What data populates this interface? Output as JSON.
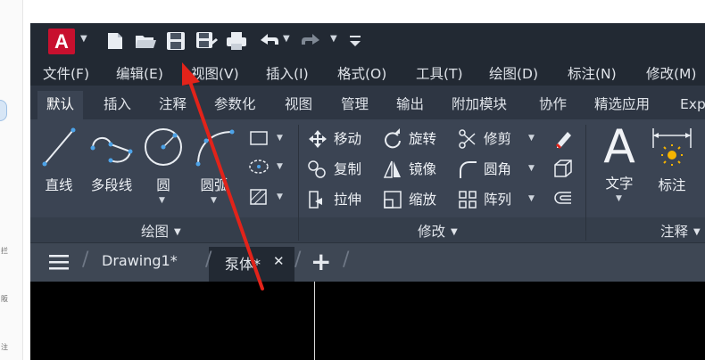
{
  "left_strip": {
    "texts": [
      "拦",
      "阪",
      "注"
    ]
  },
  "qat": {
    "logo_letter": "A",
    "icons": [
      "new-file-icon",
      "open-folder-icon",
      "save-icon",
      "save-as-icon",
      "print-icon",
      "undo-icon",
      "redo-icon",
      "customize-icon"
    ]
  },
  "menu": {
    "items": [
      "文件(F)",
      "编辑(E)",
      "视图(V)",
      "插入(I)",
      "格式(O)",
      "工具(T)",
      "绘图(D)",
      "标注(N)",
      "修改(M)"
    ]
  },
  "ribbon_tabs": [
    "默认",
    "插入",
    "注释",
    "参数化",
    "视图",
    "管理",
    "输出",
    "附加模块",
    "协作",
    "精选应用",
    "Exp"
  ],
  "ribbon": {
    "draw": {
      "line": "直线",
      "polyline": "多段线",
      "circle": "圆",
      "arc": "圆弧",
      "title": "绘图"
    },
    "modify": {
      "move": "移动",
      "rotate": "旋转",
      "trim": "修剪",
      "copy": "复制",
      "mirror": "镜像",
      "fillet": "圆角",
      "stretch": "拉伸",
      "scale": "缩放",
      "array": "阵列",
      "title": "修改"
    },
    "annotation": {
      "text": "文字",
      "dimension": "标注",
      "title": "注释"
    }
  },
  "doc_tabs": {
    "tab1": "Drawing1*",
    "tab2": "泵体*",
    "close": "✕",
    "add": "+"
  },
  "colors": {
    "accent_red": "#e2231a",
    "logo_red": "#c8102e",
    "dark_bar": "#222933",
    "panel": "#3b4453"
  }
}
